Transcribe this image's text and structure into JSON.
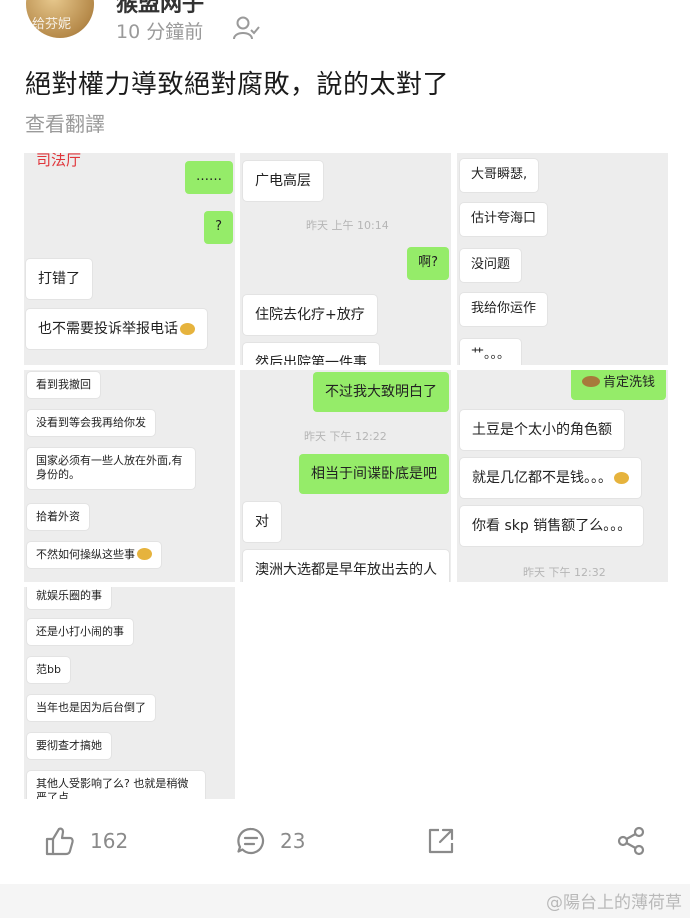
{
  "post": {
    "author": "猴盟网子",
    "avatar_text": "给芬妮",
    "time": "10 分鐘前",
    "text": "絕對權力導致絕對腐敗，說的太對了",
    "translate_label": "查看翻譯"
  },
  "screenshots": {
    "p1": {
      "header": "司法厅",
      "m1": "……",
      "m2": "?",
      "m3": "打错了",
      "m4": "也不需要投诉举报电话"
    },
    "p2": {
      "m1": "广电高层",
      "ts": "昨天 上午 10:14",
      "m2": "啊?",
      "m3": "住院去化疗+放疗",
      "m4": "然后出院第一件事"
    },
    "p3": {
      "m1": "大哥瞬瑟,",
      "m2": "估计夸海口",
      "m3": "没问题",
      "m4": "我给你运作",
      "m5": "艹。。。"
    },
    "p4": {
      "m1": "看到我撤回",
      "m2": "没看到等会我再给你发",
      "m3": "国家必须有一些人放在外面,有身份的。",
      "m4": "拾着外资",
      "m5": "不然如何操纵这些事"
    },
    "p5": {
      "m1": "不过我大致明白了",
      "ts": "昨天 下午 12:22",
      "m2": "相当于间谍卧底是吧",
      "m3": "对",
      "m4": "澳洲大选都是早年放出去的人"
    },
    "p6": {
      "m1": "肯定洗钱",
      "m2": "土豆是个太小的角色额",
      "m3": "就是几亿都不是钱。。。",
      "m4": "你看 skp 销售额了么。。。",
      "ts": "昨天 下午 12:32"
    },
    "p7": {
      "m1": "就娱乐圈的事",
      "m2": "还是小打小闹的事",
      "m3": "范bb",
      "m4": "当年也是因为后台倒了",
      "m5": "要彻查才搞她",
      "m6": "其他人受影响了么? 也就是稍微严了点"
    }
  },
  "actions": {
    "like_count": "162",
    "comment_count": "23"
  },
  "watermark": "@陽台上的薄荷草",
  "colors": {
    "wechat_green": "#95ec69",
    "red_label": "#e0353a"
  }
}
